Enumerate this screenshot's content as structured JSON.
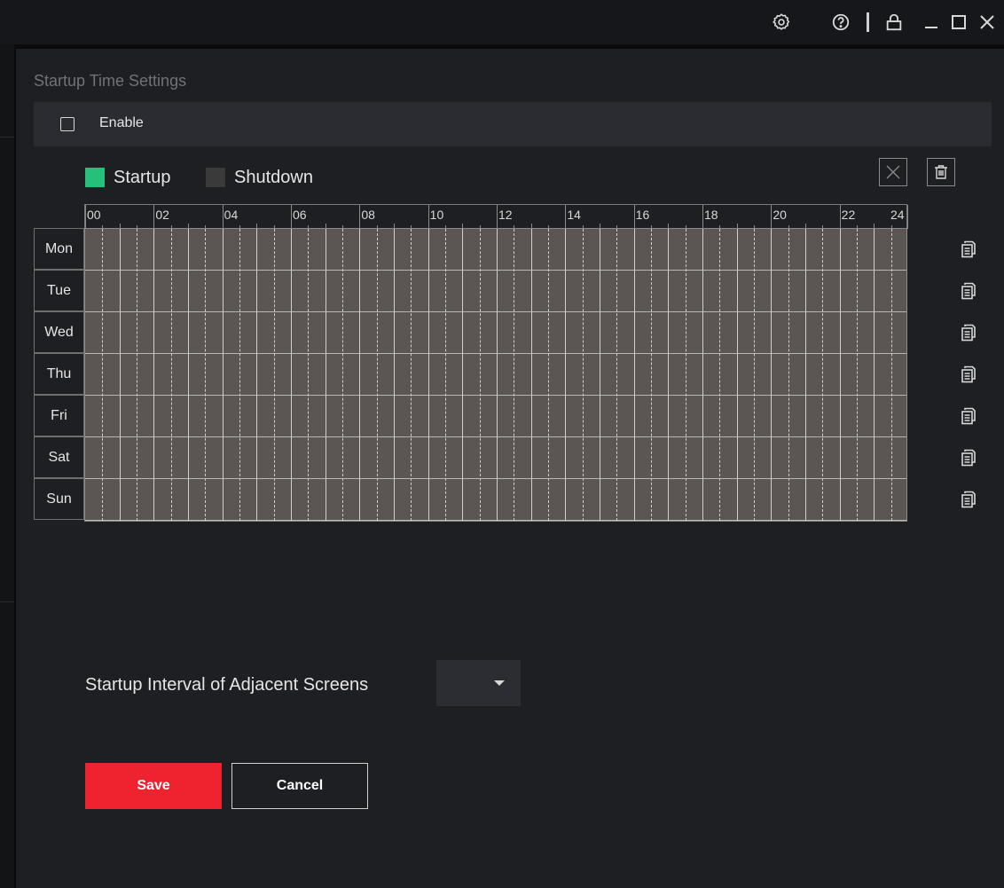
{
  "panel": {
    "title": "Startup Time Settings",
    "enable_label": "Enable",
    "enable_checked": false
  },
  "legend": {
    "startup_label": "Startup",
    "startup_color": "#27c07a",
    "shutdown_label": "Shutdown",
    "shutdown_color": "#3a3a3a"
  },
  "schedule": {
    "hour_labels": [
      "00",
      "02",
      "04",
      "06",
      "08",
      "10",
      "12",
      "14",
      "16",
      "18",
      "20",
      "22",
      "24"
    ],
    "days": [
      "Mon",
      "Tue",
      "Wed",
      "Thu",
      "Fri",
      "Sat",
      "Sun"
    ],
    "grid_color": "#5b5654"
  },
  "interval": {
    "label": "Startup Interval of Adjacent Screens",
    "value": ""
  },
  "buttons": {
    "save": "Save",
    "cancel": "Cancel"
  },
  "colors": {
    "accent": "#ef2330",
    "panel": "#1e1f23"
  },
  "icons": {
    "settings": "gear-icon",
    "help": "help-icon",
    "lock": "lock-icon",
    "minimize": "minimize-icon",
    "maximize": "maximize-icon",
    "close": "close-icon",
    "clear": "clear-x-icon",
    "delete": "trash-icon",
    "copy": "copy-icon"
  }
}
